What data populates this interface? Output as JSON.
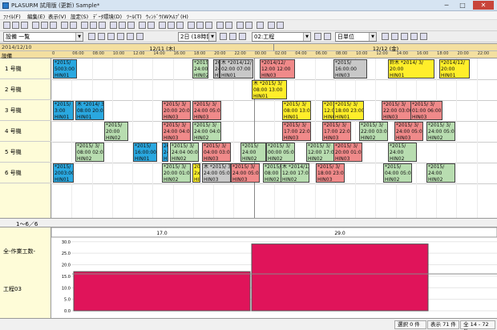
{
  "window": {
    "title": "PLASURM 試用版 (更新) Sample*",
    "minimize": "─",
    "maximize": "□",
    "close": "✕"
  },
  "menu": [
    "ﾌｧｲﾙ(F)",
    "編集(E)",
    "表示(V)",
    "設定(S)",
    "ﾃﾞｰﾀ環境(D)",
    "ﾂｰﾙ(T)",
    "ｳｨﾝﾄﾞｳ(W)",
    "ﾍﾙﾌﾟ(H)"
  ],
  "toolbar2": {
    "view_select": "設備 一覧",
    "span_select": "2日 (18時間)",
    "process_select": "02:工程",
    "unit_select": "日単位"
  },
  "gantt": {
    "header_date": "2014/12/10",
    "header_resource": "設備",
    "days": [
      {
        "label": "12/11 (木)"
      },
      {
        "label": "12/12 (金)"
      }
    ],
    "ticks": [
      "0",
      "06:00",
      "08:00",
      "10:00",
      "12:00",
      "14:00",
      "16:00",
      "18:00",
      "20:00",
      "22:00",
      "00:00",
      "02:00",
      "04:00",
      "06:00",
      "08:00",
      "10:00",
      "12:00",
      "14:00",
      "16:00",
      "18:00",
      "20:00",
      "22:00",
      "00:00"
    ],
    "rows": [
      {
        "label": "1 号機"
      },
      {
        "label": "2 号機"
      },
      {
        "label": "3 号機"
      },
      {
        "label": "4 号機"
      },
      {
        "label": "5 号機"
      },
      {
        "label": "6 号機"
      }
    ],
    "bars": [
      {
        "row": 0,
        "color": "blue",
        "text": "*2015/\n5003:00\nHIN01"
      },
      {
        "row": 0,
        "color": "green",
        "text": "*2015/ 3/\n24:00 05:00\nHIN02"
      },
      {
        "row": 0,
        "color": "gray",
        "text": "2015\n24:0\nHIN"
      },
      {
        "row": 0,
        "color": "gray",
        "text": "木 *2014/12/\n02:00 07:00\nHIN01"
      },
      {
        "row": 0,
        "color": "pink",
        "text": "*2014/12/\n12:00 12:00\nHIN03"
      },
      {
        "row": 0,
        "color": "gray",
        "text": "*2015/\n16:00:00\nHIN03"
      },
      {
        "row": 0,
        "color": "yellow",
        "text": "鈴木 *2014/ 3/\n20:00\nHIN01"
      },
      {
        "row": 0,
        "color": "yellow",
        "text": "*2014/12/\n20:00\nHIN01"
      },
      {
        "row": 1,
        "color": "yellow",
        "text": "木 *2015/ 3/\n08:00 13:00\nHIN01"
      },
      {
        "row": 2,
        "color": "blue",
        "text": "*2015/\n3:00\nHIN01"
      },
      {
        "row": 2,
        "color": "blue",
        "text": "木 *2014/ 3/\n08:00 20:00\nHIN01"
      },
      {
        "row": 2,
        "color": "pink",
        "text": "*2015/ 3/\n20:00 20:00\nHIN03"
      },
      {
        "row": 2,
        "color": "pink",
        "text": "*2015/ 3/\n24:00 05:00\nHIN03"
      },
      {
        "row": 2,
        "color": "yellow",
        "text": "*2015/ 3/\n08:00 13:00\nHIN01"
      },
      {
        "row": 2,
        "color": "yellow",
        "text": "*2015/ 3/\n12:00 17:00\nHIN01"
      },
      {
        "row": 2,
        "color": "yellow",
        "text": "*2015/ 3/\n18:00 23:00\nHIN01"
      },
      {
        "row": 2,
        "color": "pink",
        "text": "*2015/ 3/\n22:00 03:00\nHIN03"
      },
      {
        "row": 2,
        "color": "pink",
        "text": "*2015/ 3/\n01:00 06:00\nHIN03"
      },
      {
        "row": 3,
        "color": "green",
        "text": "*2015/\n20:00\nHIN02"
      },
      {
        "row": 3,
        "color": "pink",
        "text": "*2015/ 3/\n24:00 04:00\nHIN03"
      },
      {
        "row": 3,
        "color": "green",
        "text": "*2015/ 3/\n24:00 04:00\nHIN02"
      },
      {
        "row": 3,
        "color": "pink",
        "text": "*2015/ 3/\n17:00 22:00\nHIN03"
      },
      {
        "row": 3,
        "color": "pink",
        "text": "*2015/ 3/\n17:00 22:00\nHIN03"
      },
      {
        "row": 3,
        "color": "green",
        "text": "*2015/ 3/\n22:00 03:00\nHIN02"
      },
      {
        "row": 3,
        "color": "pink",
        "text": "*2015/ 3/\n24:00 05:00\nHIN03"
      },
      {
        "row": 3,
        "color": "green",
        "text": "*2015/ 3/\n24:00 05:00\nHIN02"
      },
      {
        "row": 4,
        "color": "green",
        "text": "*2015/ 3/\n08:00 02:00\nHIN02"
      },
      {
        "row": 4,
        "color": "blue",
        "text": "*2015/\n16:00:00\nHIN01"
      },
      {
        "row": 4,
        "color": "blue",
        "text": "2015\n24:0\nHIN"
      },
      {
        "row": 4,
        "color": "green",
        "text": "*2015/ 3/\n24:04 00:00\nHIN02"
      },
      {
        "row": 4,
        "color": "pink",
        "text": "*2015/ 3/\n04:00 03:00\nHIN03"
      },
      {
        "row": 4,
        "color": "green",
        "text": "*2015/\n24:00\nHIN02"
      },
      {
        "row": 4,
        "color": "green",
        "text": "*2015/ 3/\n00:00 05:00\nHIN02"
      },
      {
        "row": 4,
        "color": "green",
        "text": "*2015/ 3/\n12:00 17:00\nHIN02"
      },
      {
        "row": 4,
        "color": "pink",
        "text": "*2015/ 3/\n20:00 01:00\nHIN03"
      },
      {
        "row": 4,
        "color": "green",
        "text": "*2015/\n24:00\nHIN02"
      },
      {
        "row": 5,
        "color": "blue",
        "text": "*2015/\n2003:00\nHIN01"
      },
      {
        "row": 5,
        "color": "green",
        "text": "*2015/ 3/\n20:00 01:00\nHIN02"
      },
      {
        "row": 5,
        "color": "yellow",
        "text": "2015\n2x:0\nHIN"
      },
      {
        "row": 5,
        "color": "gray",
        "text": "木 *2015/ 3/\n24:00 05:00\nHIN03"
      },
      {
        "row": 5,
        "color": "pink",
        "text": "*2015/ 3/\n24:00 05:00\nHIN03"
      },
      {
        "row": 5,
        "color": "green",
        "text": "*2015/ 3/\n08:00 13:00\nHIN02"
      },
      {
        "row": 5,
        "color": "green",
        "text": "木 *2014/12/\n12:00 17:00\nHIN02"
      },
      {
        "row": 5,
        "color": "pink",
        "text": "*2015/ 3/\n18:00 23:00\nHIN03"
      },
      {
        "row": 5,
        "color": "green",
        "text": "*2015/\n04:00 05:00\nHIN02"
      },
      {
        "row": 5,
        "color": "green",
        "text": "*2015/\n24:00\nHIN02"
      }
    ]
  },
  "row_status": "1～6／6",
  "load_chart": {
    "labels": [
      "全-作業工数-",
      "工程03"
    ],
    "value_labels": [
      "17.0",
      "29.0"
    ]
  },
  "chart_data": {
    "type": "bar",
    "categories": [
      "12/11",
      "12/12"
    ],
    "values": [
      17.0,
      29.0
    ],
    "ylim": [
      0,
      32
    ],
    "yticks": [
      "30.0",
      "25.0",
      "20.0",
      "15.0",
      "10.0",
      "5.0",
      "0.0"
    ],
    "color": "#e0145a"
  },
  "statusbar": {
    "selected": "選択 0 件",
    "shown": "表示 71 件",
    "total": "全 14 - 72 件"
  }
}
